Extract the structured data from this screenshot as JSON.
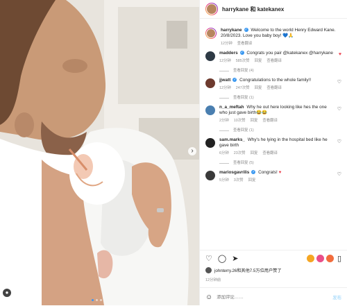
{
  "header": {
    "names": "harrykane 和 katekanex",
    "avatar_color": "#b7865f"
  },
  "caption": {
    "user": "harrykane",
    "text": "Welcome to the world Henry Edward Kane. 20/8/2023. Love you baby boy! 💙🙏",
    "time": "12分钟",
    "translate": "查看翻译"
  },
  "comments": [
    {
      "user": "madders",
      "verified": true,
      "text": "Congrats you pair @katekanex @harrykane",
      "time": "12分钟",
      "likes": "585次赞",
      "reply": "回复",
      "translate": "查看翻译",
      "replies": "查看回复 (4)",
      "avatar_color": "#2e3a45"
    },
    {
      "user": "jjwatt",
      "verified": true,
      "text": "Congratulations to the whole family!!",
      "time": "12分钟",
      "likes": "247次赞",
      "reply": "回复",
      "translate": "查看翻译",
      "replies": "查看回复 (1)",
      "avatar_color": "#6d3a2e"
    },
    {
      "user": "n_a_meftah",
      "verified": false,
      "text": "Why he out here looking like hes the one who just gave birth😂😂",
      "time": "2分钟",
      "likes": "10次赞",
      "reply": "回复",
      "translate": "查看翻译",
      "replies": "查看回复 (1)",
      "avatar_color": "#4a7fb0"
    },
    {
      "user": "sam.marks_",
      "verified": false,
      "text": "Why's he lying in the hospital bed like he gave birth",
      "time": "6分钟",
      "likes": "23次赞",
      "reply": "回复",
      "translate": "查看翻译",
      "replies": "查看回复 (5)",
      "avatar_color": "#222222"
    },
    {
      "user": "mariosgavrilis",
      "verified": true,
      "text": "Congrats!",
      "time": "5分钟",
      "likes": "3次赞",
      "reply": "回复",
      "translate": "",
      "replies": "",
      "avatar_color": "#3a3a3a"
    }
  ],
  "actions": {
    "like_icon": "heart-outline-icon",
    "comment_icon": "speech-bubble-icon",
    "share_icon": "paper-plane-icon",
    "save_icon": "bookmark-icon"
  },
  "likes": {
    "text": "johnterry.26和其他7.5万位用户赞了",
    "avatar_color": "#555555"
  },
  "post_date": "12分钟前",
  "add_comment": {
    "placeholder": "添加评论……",
    "post_label": "发布"
  },
  "colors": {
    "accent": "#3897f0",
    "border": "#efefef",
    "muted": "#8e8e8e"
  }
}
